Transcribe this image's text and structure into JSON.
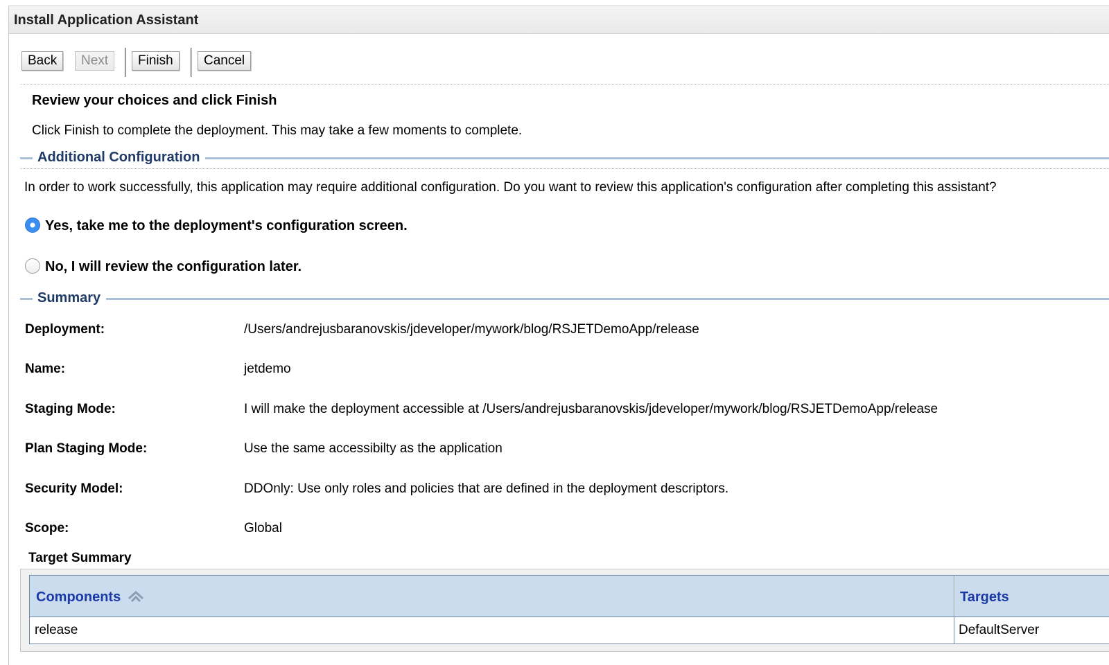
{
  "window": {
    "title": "Install Application Assistant"
  },
  "toolbar": {
    "back_label": "Back",
    "next_label": "Next",
    "finish_label": "Finish",
    "cancel_label": "Cancel"
  },
  "intro": {
    "heading": "Review your choices and click Finish",
    "text": "Click Finish to complete the deployment. This may take a few moments to complete."
  },
  "additional_config": {
    "title": "Additional Configuration",
    "question": "In order to work successfully, this application may require additional configuration. Do you want to review this application's configuration after completing this assistant?",
    "options": [
      {
        "label": "Yes, take me to the deployment's configuration screen.",
        "selected": true
      },
      {
        "label": "No, I will review the configuration later.",
        "selected": false
      }
    ]
  },
  "summary": {
    "title": "Summary",
    "rows": [
      {
        "label": "Deployment:",
        "value": "/Users/andrejusbaranovskis/jdeveloper/mywork/blog/RSJETDemoApp/release"
      },
      {
        "label": "Name:",
        "value": "jetdemo"
      },
      {
        "label": "Staging Mode:",
        "value": "I will make the deployment accessible at /Users/andrejusbaranovskis/jdeveloper/mywork/blog/RSJETDemoApp/release"
      },
      {
        "label": "Plan Staging Mode:",
        "value": "Use the same accessibilty as the application"
      },
      {
        "label": "Security Model:",
        "value": "DDOnly: Use only roles and policies that are defined in the deployment descriptors."
      },
      {
        "label": "Scope:",
        "value": "Global"
      }
    ]
  },
  "target_summary": {
    "title": "Target Summary",
    "columns": [
      "Components",
      "Targets"
    ],
    "rows": [
      {
        "component": "release",
        "target": "DefaultServer"
      }
    ]
  },
  "colors": {
    "section_rule": "#a7bfd7",
    "section_title": "#1f3a66",
    "table_header_bg": "#cbdcee",
    "table_header_text": "#1a3aa8",
    "radio_selected": "#3b8ef0"
  },
  "icons": {
    "sort": "sort-ascending-icon"
  }
}
